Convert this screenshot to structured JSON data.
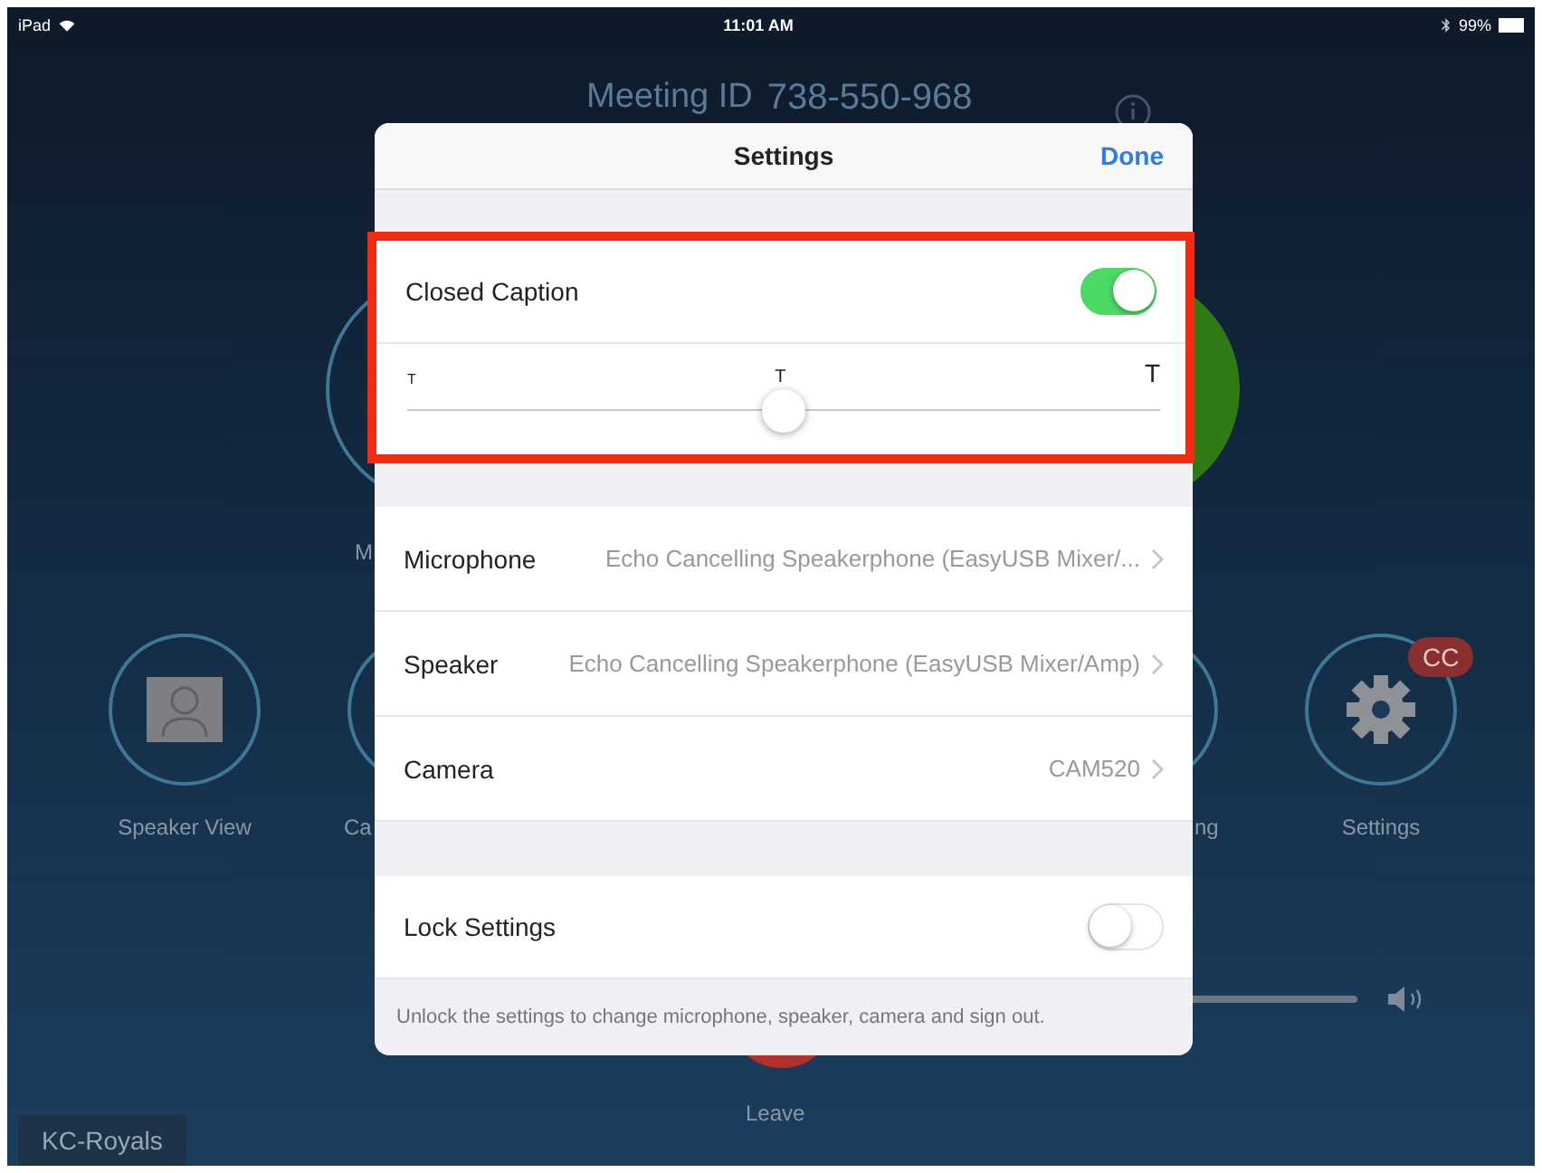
{
  "status_bar": {
    "device": "iPad",
    "time": "11:01 AM",
    "battery": "99%"
  },
  "meeting": {
    "label": "Meeting ID",
    "id": "738-550-968"
  },
  "controls": [
    {
      "kind": "mic",
      "label": "M"
    },
    {
      "kind": "speaker_view",
      "label": "Speaker View"
    },
    {
      "kind": "camera",
      "label": "Ca"
    },
    {
      "kind": "recording",
      "label": "ng"
    },
    {
      "kind": "settings",
      "label": "Settings",
      "badge": "CC"
    }
  ],
  "leave": {
    "label": "Leave"
  },
  "room_name": "KC-Royals",
  "dialog": {
    "title": "Settings",
    "done": "Done",
    "closed_caption": {
      "label": "Closed Caption",
      "on": true,
      "size_labels": [
        "T",
        "T",
        "T"
      ],
      "level": 0.5
    },
    "devices": [
      {
        "label": "Microphone",
        "value": "Echo Cancelling Speakerphone (EasyUSB Mixer/..."
      },
      {
        "label": "Speaker",
        "value": "Echo Cancelling Speakerphone (EasyUSB Mixer/Amp)"
      },
      {
        "label": "Camera",
        "value": "CAM520"
      }
    ],
    "lock": {
      "label": "Lock Settings",
      "on": false
    },
    "footnote": "Unlock the settings to change microphone, speaker, camera and sign out."
  }
}
